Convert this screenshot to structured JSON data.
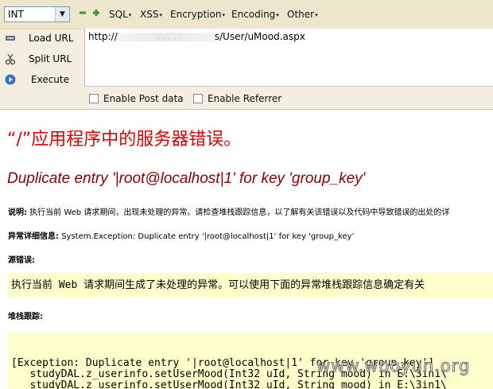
{
  "toolbar": {
    "select_value": "INT",
    "menus": [
      {
        "label": "SQL"
      },
      {
        "label": "XSS"
      },
      {
        "label": "Encryption"
      },
      {
        "label": "Encoding"
      },
      {
        "label": "Other"
      }
    ]
  },
  "actions": {
    "load_url": "Load URL",
    "split_url": "Split URL",
    "execute": "Execute"
  },
  "url": {
    "prefix": "http://",
    "masked": "· · · · ·",
    "suffix": "s/User/uMood.aspx"
  },
  "options": {
    "enable_post": "Enable Post data",
    "enable_referrer": "Enable Referrer"
  },
  "page": {
    "title": "“/”应用程序中的服务器错误。",
    "error_heading": "Duplicate entry '|root@localhost|1' for key 'group_key'",
    "desc_label": "说明:",
    "desc_text": " 执行当前 Web 请求期间，出现未处理的异常。请检查堆栈跟踪信息，以了解有关该错误以及代码中导致错误的出处的详",
    "exception_label": "异常详细信息:",
    "exception_text": " System.Exception: Duplicate entry '|root@localhost|1' for key 'group_key'",
    "source_label": "源错误:",
    "source_text": "执行当前 Web 请求期间生成了未处理的异常。可以使用下面的异常堆栈跟踪信息确定有关",
    "stack_label": "堆栈跟踪:",
    "stack_text": "[Exception: Duplicate entry '|root@localhost|1' for key 'group_key']\n   studyDAL.z_userinfo.setUserMood(Int32 uId, String mood) in E:\\3in1\\\n   studyDAL.z_userinfo.setUserMood(Int32 uId, String mood) in E:\\3in1\\",
    "watermark": "www.wooyun.org"
  }
}
